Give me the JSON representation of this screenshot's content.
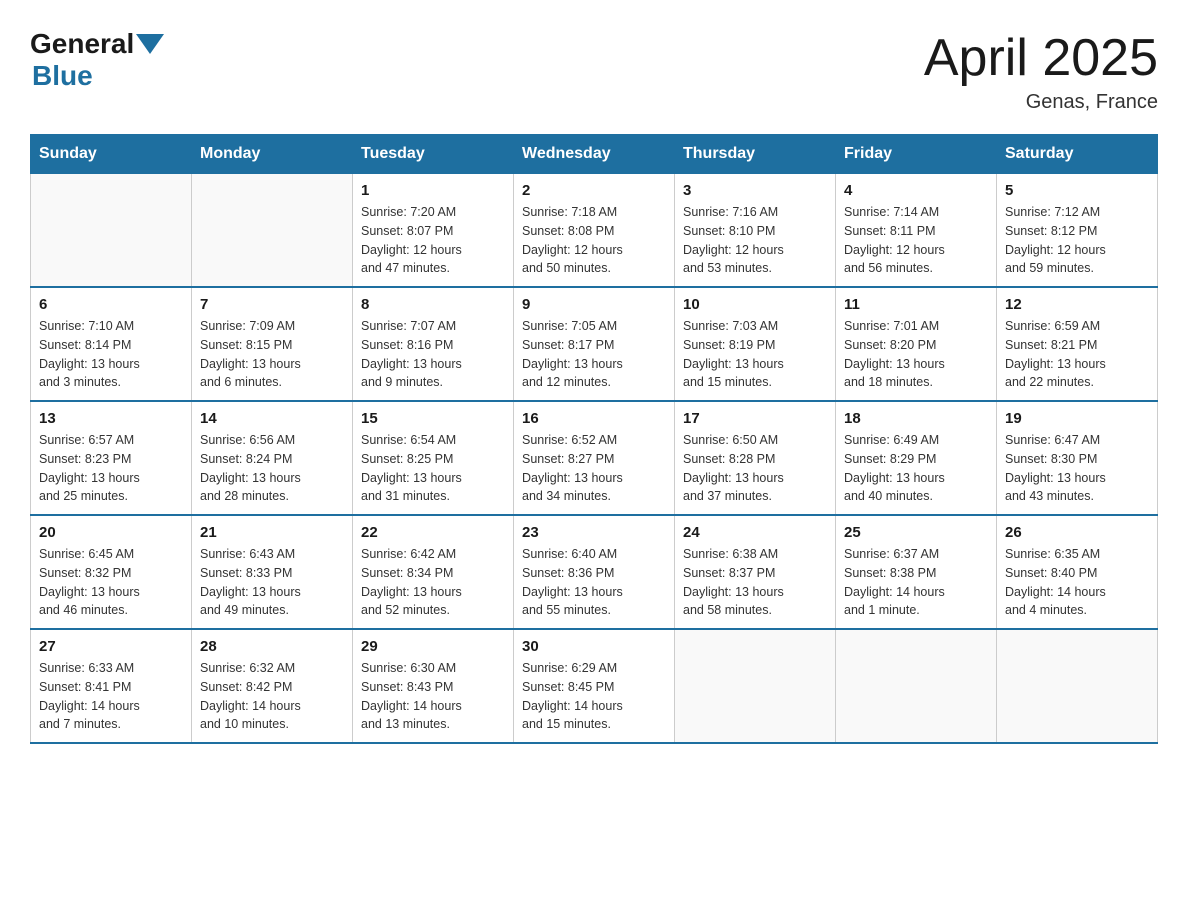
{
  "header": {
    "logo_general": "General",
    "logo_blue": "Blue",
    "month_title": "April 2025",
    "location": "Genas, France"
  },
  "weekdays": [
    "Sunday",
    "Monday",
    "Tuesday",
    "Wednesday",
    "Thursday",
    "Friday",
    "Saturday"
  ],
  "weeks": [
    [
      {
        "day": "",
        "info": ""
      },
      {
        "day": "",
        "info": ""
      },
      {
        "day": "1",
        "info": "Sunrise: 7:20 AM\nSunset: 8:07 PM\nDaylight: 12 hours\nand 47 minutes."
      },
      {
        "day": "2",
        "info": "Sunrise: 7:18 AM\nSunset: 8:08 PM\nDaylight: 12 hours\nand 50 minutes."
      },
      {
        "day": "3",
        "info": "Sunrise: 7:16 AM\nSunset: 8:10 PM\nDaylight: 12 hours\nand 53 minutes."
      },
      {
        "day": "4",
        "info": "Sunrise: 7:14 AM\nSunset: 8:11 PM\nDaylight: 12 hours\nand 56 minutes."
      },
      {
        "day": "5",
        "info": "Sunrise: 7:12 AM\nSunset: 8:12 PM\nDaylight: 12 hours\nand 59 minutes."
      }
    ],
    [
      {
        "day": "6",
        "info": "Sunrise: 7:10 AM\nSunset: 8:14 PM\nDaylight: 13 hours\nand 3 minutes."
      },
      {
        "day": "7",
        "info": "Sunrise: 7:09 AM\nSunset: 8:15 PM\nDaylight: 13 hours\nand 6 minutes."
      },
      {
        "day": "8",
        "info": "Sunrise: 7:07 AM\nSunset: 8:16 PM\nDaylight: 13 hours\nand 9 minutes."
      },
      {
        "day": "9",
        "info": "Sunrise: 7:05 AM\nSunset: 8:17 PM\nDaylight: 13 hours\nand 12 minutes."
      },
      {
        "day": "10",
        "info": "Sunrise: 7:03 AM\nSunset: 8:19 PM\nDaylight: 13 hours\nand 15 minutes."
      },
      {
        "day": "11",
        "info": "Sunrise: 7:01 AM\nSunset: 8:20 PM\nDaylight: 13 hours\nand 18 minutes."
      },
      {
        "day": "12",
        "info": "Sunrise: 6:59 AM\nSunset: 8:21 PM\nDaylight: 13 hours\nand 22 minutes."
      }
    ],
    [
      {
        "day": "13",
        "info": "Sunrise: 6:57 AM\nSunset: 8:23 PM\nDaylight: 13 hours\nand 25 minutes."
      },
      {
        "day": "14",
        "info": "Sunrise: 6:56 AM\nSunset: 8:24 PM\nDaylight: 13 hours\nand 28 minutes."
      },
      {
        "day": "15",
        "info": "Sunrise: 6:54 AM\nSunset: 8:25 PM\nDaylight: 13 hours\nand 31 minutes."
      },
      {
        "day": "16",
        "info": "Sunrise: 6:52 AM\nSunset: 8:27 PM\nDaylight: 13 hours\nand 34 minutes."
      },
      {
        "day": "17",
        "info": "Sunrise: 6:50 AM\nSunset: 8:28 PM\nDaylight: 13 hours\nand 37 minutes."
      },
      {
        "day": "18",
        "info": "Sunrise: 6:49 AM\nSunset: 8:29 PM\nDaylight: 13 hours\nand 40 minutes."
      },
      {
        "day": "19",
        "info": "Sunrise: 6:47 AM\nSunset: 8:30 PM\nDaylight: 13 hours\nand 43 minutes."
      }
    ],
    [
      {
        "day": "20",
        "info": "Sunrise: 6:45 AM\nSunset: 8:32 PM\nDaylight: 13 hours\nand 46 minutes."
      },
      {
        "day": "21",
        "info": "Sunrise: 6:43 AM\nSunset: 8:33 PM\nDaylight: 13 hours\nand 49 minutes."
      },
      {
        "day": "22",
        "info": "Sunrise: 6:42 AM\nSunset: 8:34 PM\nDaylight: 13 hours\nand 52 minutes."
      },
      {
        "day": "23",
        "info": "Sunrise: 6:40 AM\nSunset: 8:36 PM\nDaylight: 13 hours\nand 55 minutes."
      },
      {
        "day": "24",
        "info": "Sunrise: 6:38 AM\nSunset: 8:37 PM\nDaylight: 13 hours\nand 58 minutes."
      },
      {
        "day": "25",
        "info": "Sunrise: 6:37 AM\nSunset: 8:38 PM\nDaylight: 14 hours\nand 1 minute."
      },
      {
        "day": "26",
        "info": "Sunrise: 6:35 AM\nSunset: 8:40 PM\nDaylight: 14 hours\nand 4 minutes."
      }
    ],
    [
      {
        "day": "27",
        "info": "Sunrise: 6:33 AM\nSunset: 8:41 PM\nDaylight: 14 hours\nand 7 minutes."
      },
      {
        "day": "28",
        "info": "Sunrise: 6:32 AM\nSunset: 8:42 PM\nDaylight: 14 hours\nand 10 minutes."
      },
      {
        "day": "29",
        "info": "Sunrise: 6:30 AM\nSunset: 8:43 PM\nDaylight: 14 hours\nand 13 minutes."
      },
      {
        "day": "30",
        "info": "Sunrise: 6:29 AM\nSunset: 8:45 PM\nDaylight: 14 hours\nand 15 minutes."
      },
      {
        "day": "",
        "info": ""
      },
      {
        "day": "",
        "info": ""
      },
      {
        "day": "",
        "info": ""
      }
    ]
  ]
}
